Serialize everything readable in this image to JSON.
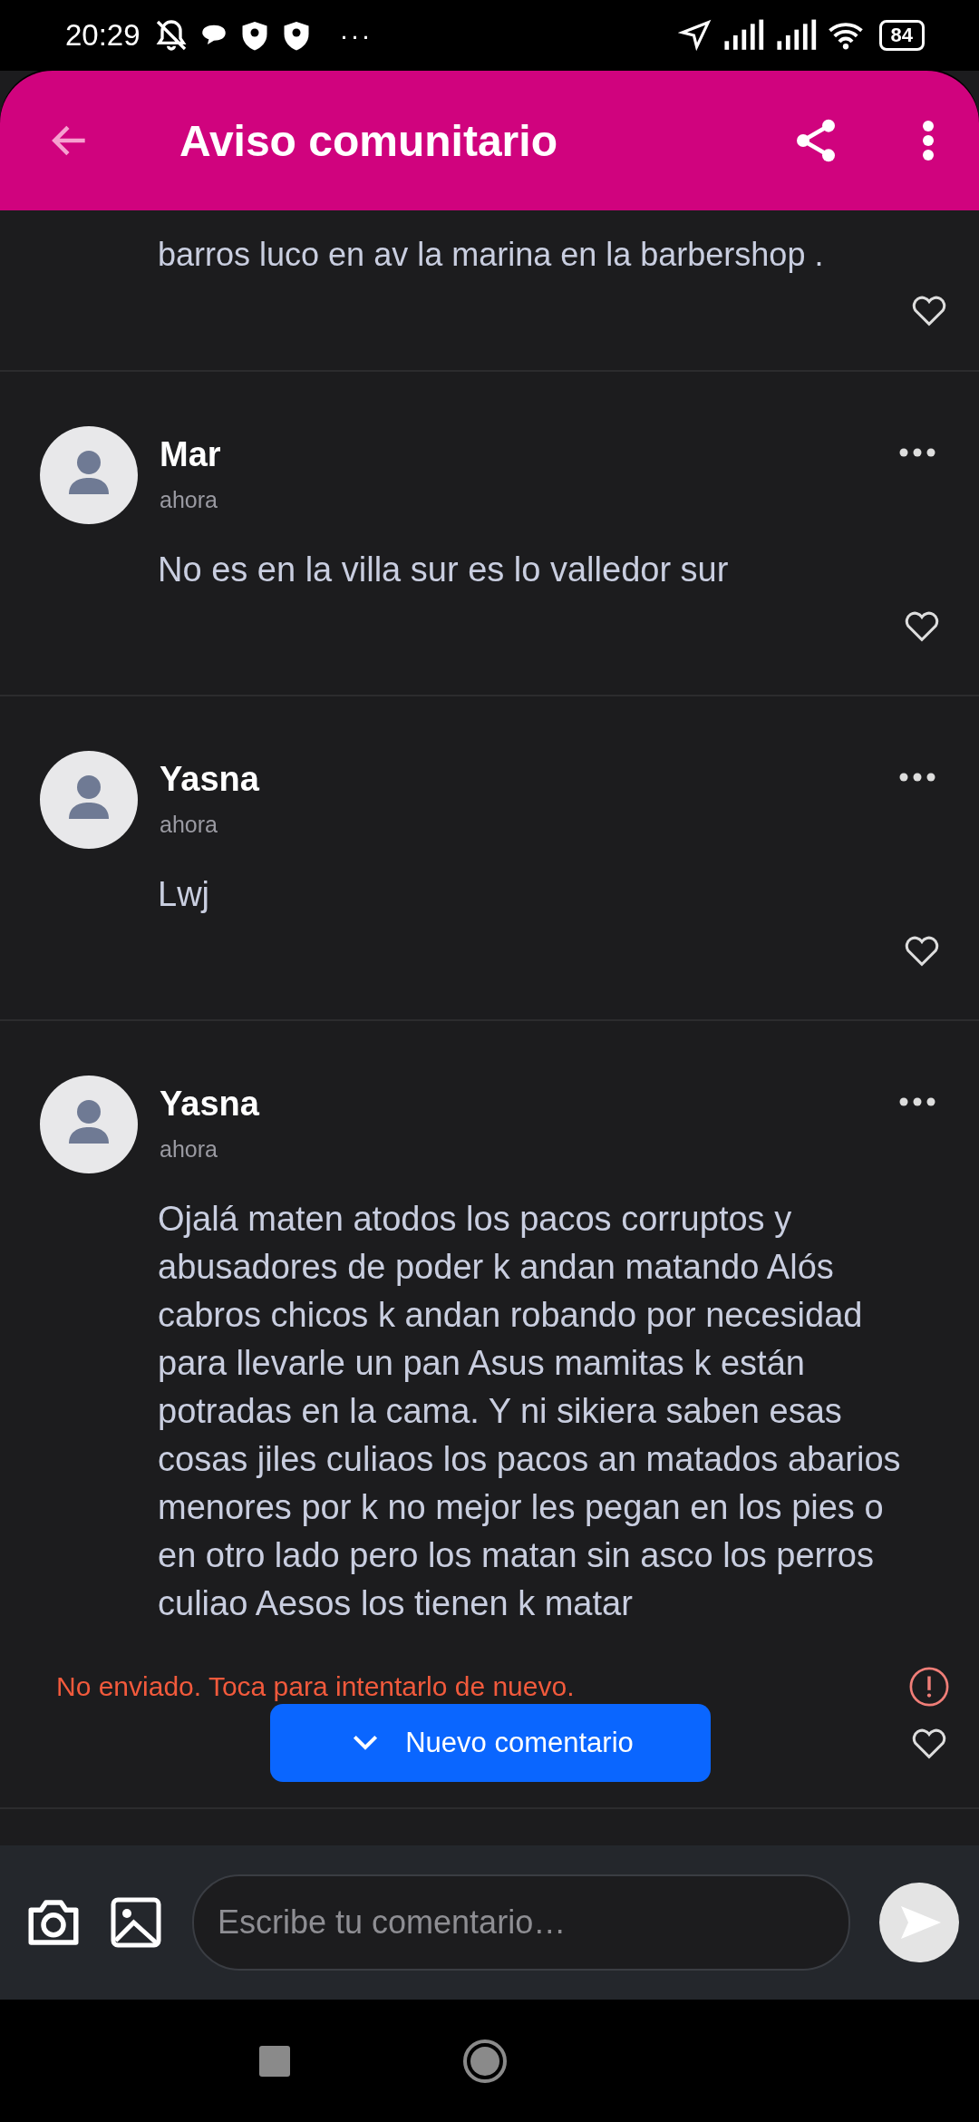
{
  "status_bar": {
    "time": "20:29",
    "more": "···",
    "battery": "84"
  },
  "header": {
    "title": "Aviso comunitario"
  },
  "partial_comment": {
    "text": "barros luco en av la marina en la barbershop ."
  },
  "comments": [
    {
      "author": "Mar",
      "time": "ahora",
      "text": "No es en la villa sur es lo valledor sur"
    },
    {
      "author": "Yasna",
      "time": "ahora",
      "text": "Lwj"
    },
    {
      "author": "Yasna",
      "time": "ahora",
      "text": "Ojalá maten atodos los pacos corruptos y abusadores  de poder k andan matando Alós cabros chicos k andan robando por necesidad para llevarle un pan Asus mamitas k están potradas en la cama. Y ni sikiera saben esas cosas jiles culiaos los pacos an matados abarios menores por k no mejor les pegan en los pies o en otro lado pero los matan sin asco los perros culiao Aesos los tienen k matar",
      "error": "No enviado. Toca para intentarlo de nuevo."
    }
  ],
  "new_comment_button": "Nuevo comentario",
  "composer": {
    "placeholder": "Escribe tu comentario…"
  }
}
